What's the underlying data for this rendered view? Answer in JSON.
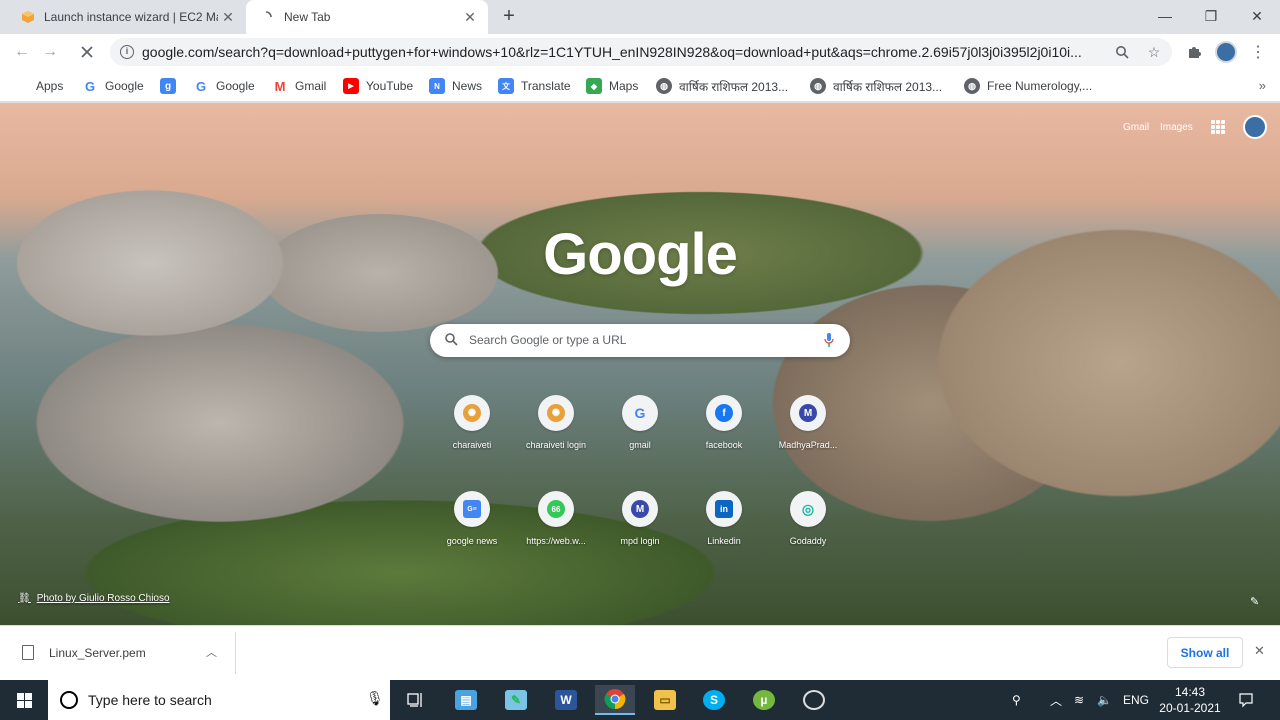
{
  "tabs": [
    {
      "title": "Launch instance wizard | EC2 Ma",
      "active": false
    },
    {
      "title": "New Tab",
      "active": true
    }
  ],
  "new_tab_symbol": "+",
  "window_controls": {
    "minimize": "—",
    "restore": "❐",
    "close": "✕"
  },
  "toolbar": {
    "url": "google.com/search?q=download+puttygen+for+windows+10&rlz=1C1YTUH_enIN928IN928&oq=download+put&aqs=chrome.2.69i57j0l3j0i395l2j0i10i..."
  },
  "bookmarks": [
    {
      "label": "Apps",
      "icon": "apps-grid-icon",
      "color": "#4285f4"
    },
    {
      "label": "Google",
      "icon": "google-g-icon",
      "color": "#4285f4"
    },
    {
      "label": "",
      "icon": "google-plus-icon",
      "color": "#4285f4"
    },
    {
      "label": "Google",
      "icon": "google-g-icon",
      "color": "#4285f4"
    },
    {
      "label": "Gmail",
      "icon": "gmail-icon",
      "color": "#ea4335"
    },
    {
      "label": "YouTube",
      "icon": "youtube-icon",
      "color": "#ff0000"
    },
    {
      "label": "News",
      "icon": "news-icon",
      "color": "#4285f4"
    },
    {
      "label": "Translate",
      "icon": "translate-icon",
      "color": "#4285f4"
    },
    {
      "label": "Maps",
      "icon": "maps-icon",
      "color": "#34a853"
    },
    {
      "label": "वार्षिक राशिफल 2013...",
      "icon": "globe-icon",
      "color": "#5f6368"
    },
    {
      "label": "वार्षिक राशिफल 2013...",
      "icon": "globe-icon",
      "color": "#5f6368"
    },
    {
      "label": "Free Numerology,...",
      "icon": "globe-icon",
      "color": "#5f6368"
    }
  ],
  "ntp": {
    "top_links": {
      "gmail": "Gmail",
      "images": "Images"
    },
    "logo": "Google",
    "search_placeholder": "Search Google or type a URL",
    "shortcuts": [
      {
        "label": "charaiveti",
        "glyph": "✺",
        "color": "#e8a03a"
      },
      {
        "label": "charaiveti login",
        "glyph": "✺",
        "color": "#e8a03a"
      },
      {
        "label": "gmail",
        "glyph": "G",
        "color": "#4285f4"
      },
      {
        "label": "facebook",
        "glyph": "f",
        "color": "#1877f2"
      },
      {
        "label": "MadhyaPrad...",
        "glyph": "M",
        "color": "#3949ab"
      },
      {
        "label": "google news",
        "glyph": "G≡",
        "color": "#4285f4"
      },
      {
        "label": "https://web.w...",
        "glyph": "66",
        "color": "#34c759"
      },
      {
        "label": "mpd login",
        "glyph": "M",
        "color": "#3949ab"
      },
      {
        "label": "Linkedin",
        "glyph": "in",
        "color": "#0a66c2"
      },
      {
        "label": "Godaddy",
        "glyph": "◎",
        "color": "#1bb5a5"
      }
    ],
    "photo_credit": "Photo by Giulio Rosso Chioso"
  },
  "download_bar": {
    "filename": "Linux_Server.pem",
    "show_all": "Show all"
  },
  "taskbar": {
    "search_placeholder": "Type here to search",
    "language": "ENG",
    "time": "14:43",
    "date": "20-01-2021"
  }
}
